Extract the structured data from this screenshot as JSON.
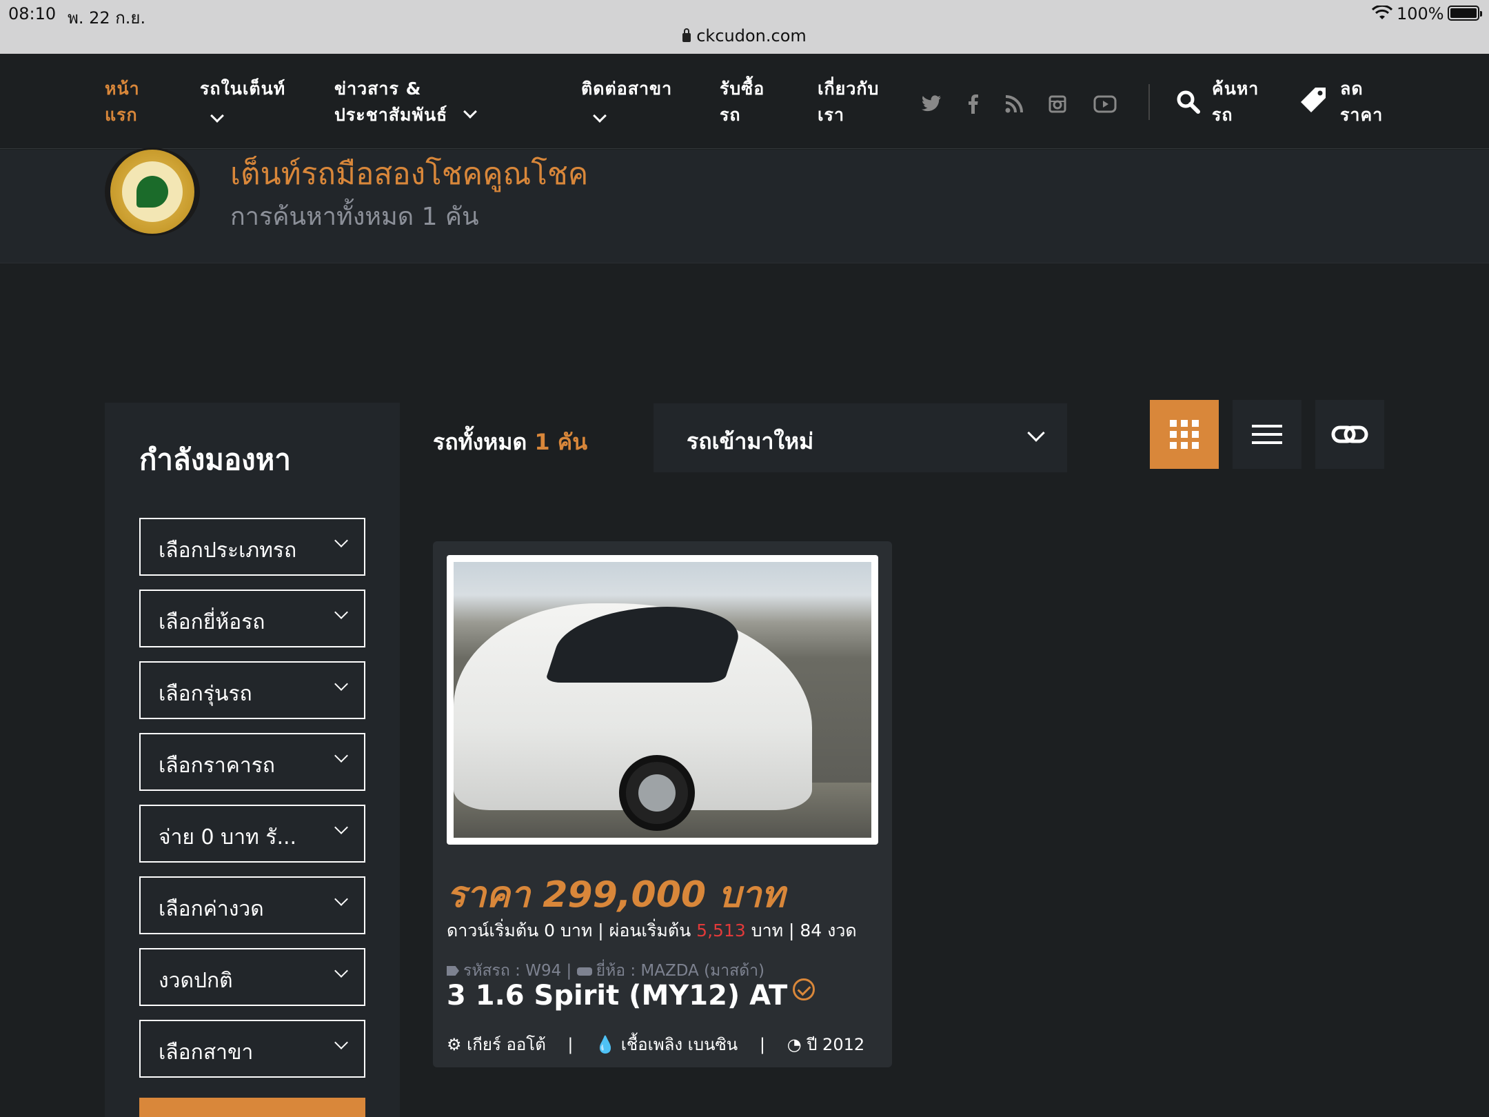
{
  "status_bar": {
    "time": "08:10",
    "date": "พ. 22 ก.ย.",
    "url": "ckcudon.com",
    "battery": "100%"
  },
  "nav": {
    "items": [
      {
        "line1": "หน้า",
        "line2": "แรก"
      },
      {
        "line1": "รถในเต็นท์"
      },
      {
        "line1": "ข่าวสาร &",
        "line2": "ประชาสัมพันธ์"
      },
      {
        "line1": "ติดต่อสาขา"
      },
      {
        "line1": "รับซื้อ",
        "line2": "รถ"
      },
      {
        "line1": "เกี่ยวกับ",
        "line2": "เรา"
      }
    ],
    "social_icons": [
      "twitter-icon",
      "facebook-icon",
      "rss-icon",
      "instagram-icon",
      "youtube-icon"
    ],
    "search": {
      "line1": "ค้นหา",
      "line2": "รถ"
    },
    "discount": {
      "line1": "ลด",
      "line2": "ราคา"
    }
  },
  "header": {
    "title": "เต็นท์รถมือสองโชคคูณโชค",
    "subtitle": "การค้นหาทั้งหมด 1 คัน"
  },
  "sidebar": {
    "heading": "กำลังมองหา",
    "filters": [
      "เลือกประเภทรถ",
      "เลือกยี่ห้อรถ",
      "เลือกรุ่นรถ",
      "เลือกราคารถ",
      "จ่าย 0 บาท รั...",
      "เลือกค่างวด",
      "งวดปกติ",
      "เลือกสาขา"
    ]
  },
  "toolbar": {
    "total_prefix": "รถทั้งหมด",
    "total_count": "1",
    "total_suffix": "คัน",
    "sort_selected": "รถเข้ามาใหม่"
  },
  "listing": {
    "price": "ราคา 299,000 บาท",
    "finance_prefix": "ดาวน์เริ่มต้น 0 บาท | ผ่อนเริ่มต้น",
    "finance_monthly": "5,513",
    "finance_suffix": "บาท | 84 งวด",
    "code": "รหัสรถ : W94",
    "brand": "ยี่ห้อ : MAZDA (มาสด้า)",
    "model": "3 1.6 Spirit (MY12) AT",
    "gear": "เกียร์ ออโต้",
    "fuel": "เชื้อเพลิง เบนซิน",
    "year": "ปี 2012"
  },
  "colors": {
    "accent": "#d9873a",
    "background": "#1c1f21",
    "panel": "#22262a",
    "highlight": "#e03a3a"
  }
}
